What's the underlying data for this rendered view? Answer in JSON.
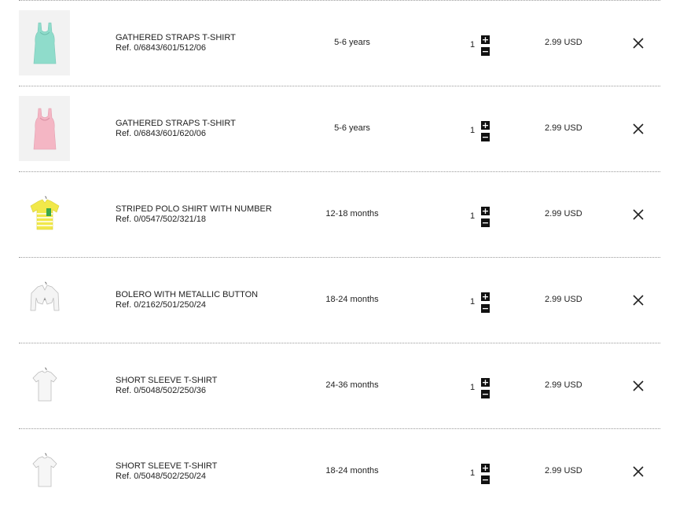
{
  "cart": {
    "items": [
      {
        "name": "GATHERED STRAPS T-SHIRT",
        "ref": "Ref. 0/6843/601/512/06",
        "size": "5-6 years",
        "quantity": "1",
        "price": "2.99 USD",
        "image_color": "#8fdccb",
        "image_type": "tank-top"
      },
      {
        "name": "GATHERED STRAPS T-SHIRT",
        "ref": "Ref. 0/6843/601/620/06",
        "size": "5-6 years",
        "quantity": "1",
        "price": "2.99 USD",
        "image_color": "#f4b6c4",
        "image_type": "tank-top"
      },
      {
        "name": "STRIPED POLO SHIRT WITH NUMBER",
        "ref": "Ref. 0/0547/502/321/18",
        "size": "12-18 months",
        "quantity": "1",
        "price": "2.99 USD",
        "image_color": "#f1e84a",
        "image_type": "polo"
      },
      {
        "name": "BOLERO WITH METALLIC BUTTON",
        "ref": "Ref. 0/2162/501/250/24",
        "size": "18-24 months",
        "quantity": "1",
        "price": "2.99 USD",
        "image_color": "#f4f4f4",
        "image_type": "bolero"
      },
      {
        "name": "SHORT SLEEVE T-SHIRT",
        "ref": "Ref. 0/5048/502/250/36",
        "size": "24-36 months",
        "quantity": "1",
        "price": "2.99 USD",
        "image_color": "#f6f6f6",
        "image_type": "tshirt"
      },
      {
        "name": "SHORT SLEEVE T-SHIRT",
        "ref": "Ref. 0/5048/502/250/24",
        "size": "18-24 months",
        "quantity": "1",
        "price": "2.99 USD",
        "image_color": "#f6f6f6",
        "image_type": "tshirt"
      }
    ],
    "controls": {
      "plus_glyph": "+",
      "minus_glyph": "−",
      "remove_icon": "close-icon"
    }
  }
}
